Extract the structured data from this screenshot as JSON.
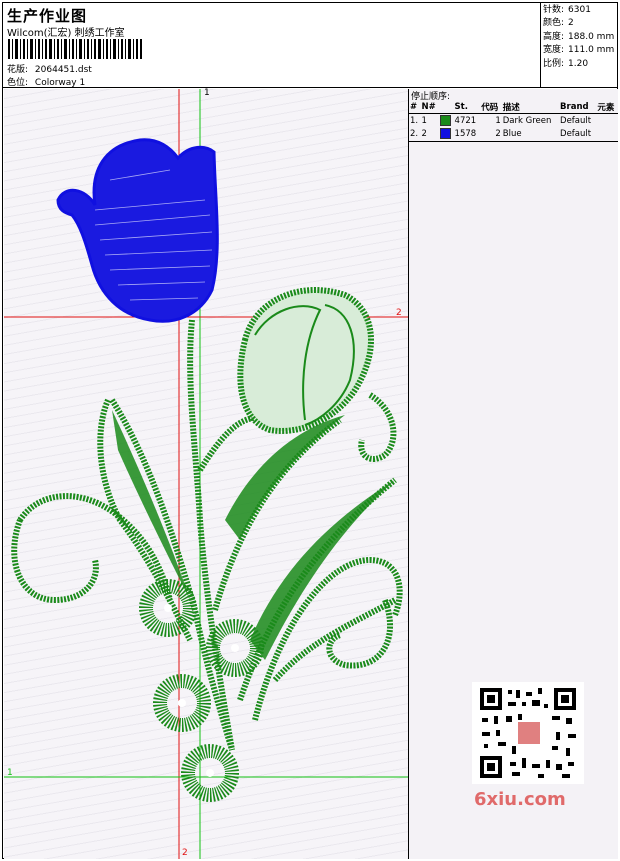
{
  "header": {
    "title": "生产作业图",
    "vendor": "Wilcom(汇宏) 刺绣工作室",
    "design_label": "花版:",
    "design_value": "2064451.dst",
    "colorway_label": "色位:",
    "colorway_value": "Colorway 1"
  },
  "specs": [
    {
      "label": "针数:",
      "value": "6301"
    },
    {
      "label": "颜色:",
      "value": "2"
    },
    {
      "label": "高度:",
      "value": "188.0 mm"
    },
    {
      "label": "宽度:",
      "value": "111.0 mm"
    },
    {
      "label": "比例:",
      "value": "1.20"
    }
  ],
  "stop_sequence": {
    "title": "停止顺序:",
    "columns": [
      "#",
      "N#",
      "St.",
      "代码",
      "描述",
      "Brand",
      "元素"
    ],
    "rows": [
      {
        "idx": "1.",
        "n": "1",
        "color": "#1a8a1a",
        "stitches": "4721",
        "code": "1",
        "desc": "Dark Green",
        "brand": "Default"
      },
      {
        "idx": "2.",
        "n": "2",
        "color": "#1010e0",
        "stitches": "1578",
        "code": "2",
        "desc": "Blue",
        "brand": "Default"
      }
    ]
  },
  "guides": {
    "v1_label": "1",
    "h2_label": "2",
    "h1_label": "1",
    "v2_label": "2"
  },
  "colors": {
    "green": "#1a8a1a",
    "blue": "#1010e0",
    "guide_red": "#e01010",
    "guide_green": "#10c010"
  },
  "watermark": "6xiu.com"
}
